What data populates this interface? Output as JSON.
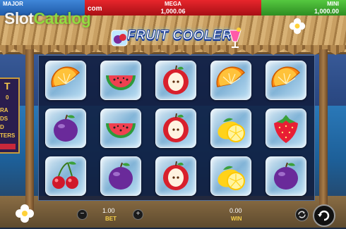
{
  "jackpots": {
    "major": {
      "label": "MAJOR",
      "value": ""
    },
    "com_text": "com",
    "mega": {
      "label": "MEGA",
      "value": "1,000.06"
    },
    "mini": {
      "label": "MINI",
      "value": "1,000.00"
    }
  },
  "watermark": {
    "part_a": "Slot",
    "part_b": "Catalog"
  },
  "logo": {
    "text": "FRUIT COOLER"
  },
  "left_panel": {
    "title": "T",
    "lines": [
      "0",
      "RA",
      "DS",
      "D",
      "TERS"
    ]
  },
  "reels": [
    [
      "orange",
      "plum",
      "cherries"
    ],
    [
      "watermelon",
      "watermelon",
      "plum"
    ],
    [
      "apple",
      "apple",
      "apple"
    ],
    [
      "orange",
      "lemon",
      "lemon"
    ],
    [
      "orange",
      "strawberry",
      "plum"
    ]
  ],
  "bottom": {
    "minus_icon": "minus-icon",
    "plus_icon": "plus-icon",
    "bet_value": "1.00",
    "bet_label": "BET",
    "win_value": "0.00",
    "win_label": "WIN",
    "autoplay_icon": "autoplay-icon",
    "spin_icon": "spin-icon"
  },
  "colors": {
    "major": "#2f74c8",
    "mega": "#d41f26",
    "mini": "#45b034",
    "accent": "#f6d04a"
  }
}
